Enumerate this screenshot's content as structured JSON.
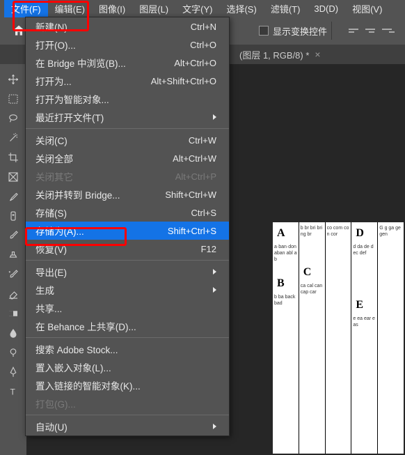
{
  "menubar": {
    "file": "文件(F)",
    "edit": "编辑(E)",
    "image": "图像(I)",
    "layer": "图层(L)",
    "type": "文字(Y)",
    "select": "选择(S)",
    "filter": "滤镜(T)",
    "threeD": "3D(D)",
    "view": "视图(V)"
  },
  "options": {
    "showTransform": "显示变换控件"
  },
  "tab": {
    "title": "(图层 1, RGB/8) *"
  },
  "fileMenu": [
    {
      "type": "item",
      "label": "新建(N)...",
      "shortcut": "Ctrl+N",
      "name": "new"
    },
    {
      "type": "item",
      "label": "打开(O)...",
      "shortcut": "Ctrl+O",
      "name": "open"
    },
    {
      "type": "item",
      "label": "在 Bridge 中浏览(B)...",
      "shortcut": "Alt+Ctrl+O",
      "name": "browse-in-bridge"
    },
    {
      "type": "item",
      "label": "打开为...",
      "shortcut": "Alt+Shift+Ctrl+O",
      "name": "open-as"
    },
    {
      "type": "item",
      "label": "打开为智能对象...",
      "shortcut": "",
      "name": "open-as-smart-object"
    },
    {
      "type": "submenu",
      "label": "最近打开文件(T)",
      "shortcut": "",
      "name": "open-recent"
    },
    {
      "type": "sep"
    },
    {
      "type": "item",
      "label": "关闭(C)",
      "shortcut": "Ctrl+W",
      "name": "close"
    },
    {
      "type": "item",
      "label": "关闭全部",
      "shortcut": "Alt+Ctrl+W",
      "name": "close-all"
    },
    {
      "type": "item",
      "label": "关闭其它",
      "shortcut": "Alt+Ctrl+P",
      "name": "close-others",
      "disabled": true
    },
    {
      "type": "item",
      "label": "关闭并转到 Bridge...",
      "shortcut": "Shift+Ctrl+W",
      "name": "close-go-to-bridge"
    },
    {
      "type": "item",
      "label": "存储(S)",
      "shortcut": "Ctrl+S",
      "name": "save"
    },
    {
      "type": "item",
      "label": "存储为(A)...",
      "shortcut": "Shift+Ctrl+S",
      "name": "save-as",
      "highlighted": true
    },
    {
      "type": "item",
      "label": "恢复(V)",
      "shortcut": "F12",
      "name": "revert"
    },
    {
      "type": "sep"
    },
    {
      "type": "submenu",
      "label": "导出(E)",
      "shortcut": "",
      "name": "export"
    },
    {
      "type": "submenu",
      "label": "生成",
      "shortcut": "",
      "name": "generate"
    },
    {
      "type": "item",
      "label": "共享...",
      "shortcut": "",
      "name": "share"
    },
    {
      "type": "item",
      "label": "在 Behance 上共享(D)...",
      "shortcut": "",
      "name": "share-on-behance"
    },
    {
      "type": "sep"
    },
    {
      "type": "item",
      "label": "搜索 Adobe Stock...",
      "shortcut": "",
      "name": "search-adobe-stock"
    },
    {
      "type": "item",
      "label": "置入嵌入对象(L)...",
      "shortcut": "",
      "name": "place-embedded"
    },
    {
      "type": "item",
      "label": "置入链接的智能对象(K)...",
      "shortcut": "",
      "name": "place-linked"
    },
    {
      "type": "item",
      "label": "打包(G)...",
      "shortcut": "",
      "name": "package",
      "disabled": true
    },
    {
      "type": "sep"
    },
    {
      "type": "submenu",
      "label": "自动(U)",
      "shortcut": "",
      "name": "automate"
    }
  ],
  "doc": {
    "letters": [
      "A",
      "B",
      "C",
      "D",
      "E"
    ]
  }
}
